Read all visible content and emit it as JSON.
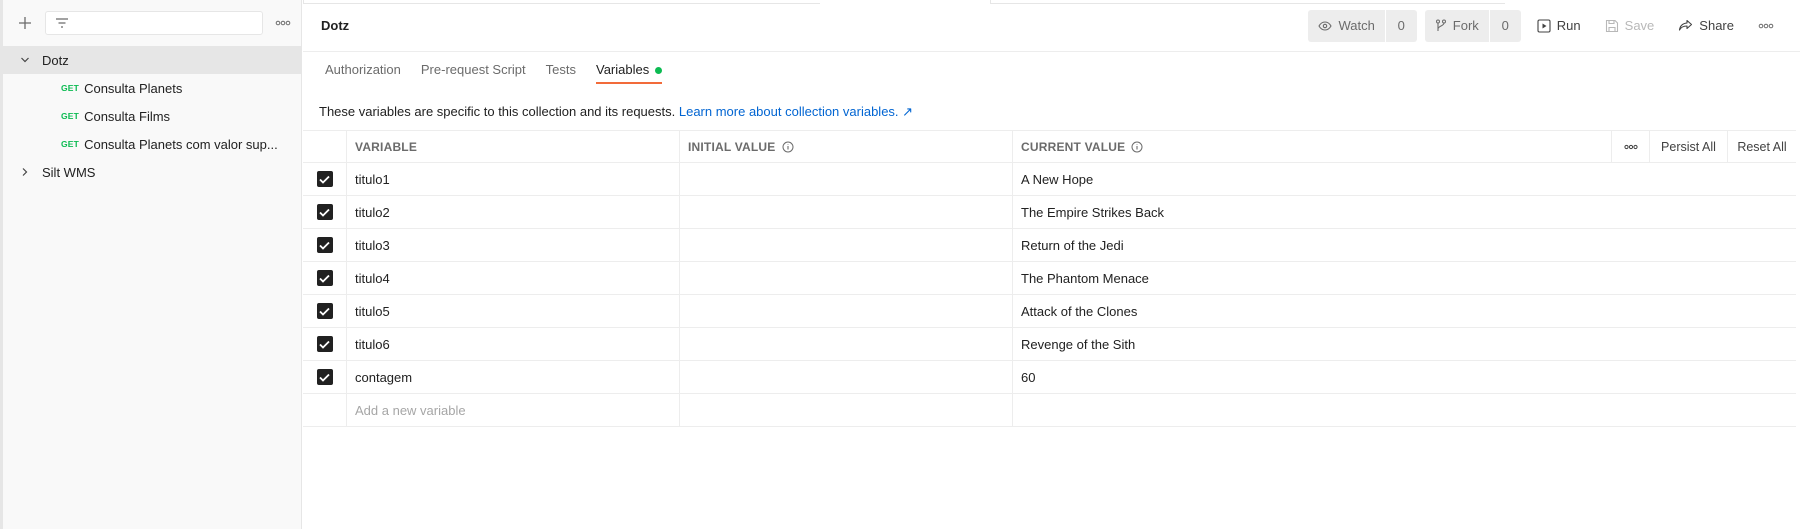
{
  "sidebar": {
    "filter_placeholder": "",
    "collections": [
      {
        "name": "Dotz",
        "expanded": true,
        "selected": true,
        "requests": [
          {
            "method": "GET",
            "name": "Consulta Planets"
          },
          {
            "method": "GET",
            "name": "Consulta Films"
          },
          {
            "method": "GET",
            "name": "Consulta Planets com valor sup..."
          }
        ]
      },
      {
        "name": "Silt WMS",
        "expanded": false,
        "selected": false
      }
    ]
  },
  "header": {
    "title": "Dotz",
    "watch_label": "Watch",
    "watch_count": "0",
    "fork_label": "Fork",
    "fork_count": "0",
    "run_label": "Run",
    "save_label": "Save",
    "share_label": "Share"
  },
  "tabs": [
    {
      "label": "Authorization",
      "active": false
    },
    {
      "label": "Pre-request Script",
      "active": false
    },
    {
      "label": "Tests",
      "active": false
    },
    {
      "label": "Variables",
      "active": true
    }
  ],
  "description": {
    "text": "These variables are specific to this collection and its requests.",
    "link": "Learn more about collection variables. ↗"
  },
  "table": {
    "headers": {
      "variable": "VARIABLE",
      "initial_value": "INITIAL VALUE",
      "current_value": "CURRENT VALUE",
      "persist_all": "Persist All",
      "reset_all": "Reset All"
    },
    "rows": [
      {
        "checked": true,
        "variable": "titulo1",
        "initial": "",
        "current": "A New Hope"
      },
      {
        "checked": true,
        "variable": "titulo2",
        "initial": "",
        "current": "The Empire Strikes Back"
      },
      {
        "checked": true,
        "variable": "titulo3",
        "initial": "",
        "current": "Return of the Jedi"
      },
      {
        "checked": true,
        "variable": "titulo4",
        "initial": "",
        "current": "The Phantom Menace"
      },
      {
        "checked": true,
        "variable": "titulo5",
        "initial": "",
        "current": "Attack of the Clones"
      },
      {
        "checked": true,
        "variable": "titulo6",
        "initial": "",
        "current": "Revenge of the Sith"
      },
      {
        "checked": true,
        "variable": "contagem",
        "initial": "",
        "current": "60"
      }
    ],
    "add_placeholder": "Add a new variable"
  },
  "colors": {
    "accent": "#f26b3a",
    "get_method": "#0cbb52",
    "link": "#0265d2",
    "status_dot": "#0cbb52"
  }
}
